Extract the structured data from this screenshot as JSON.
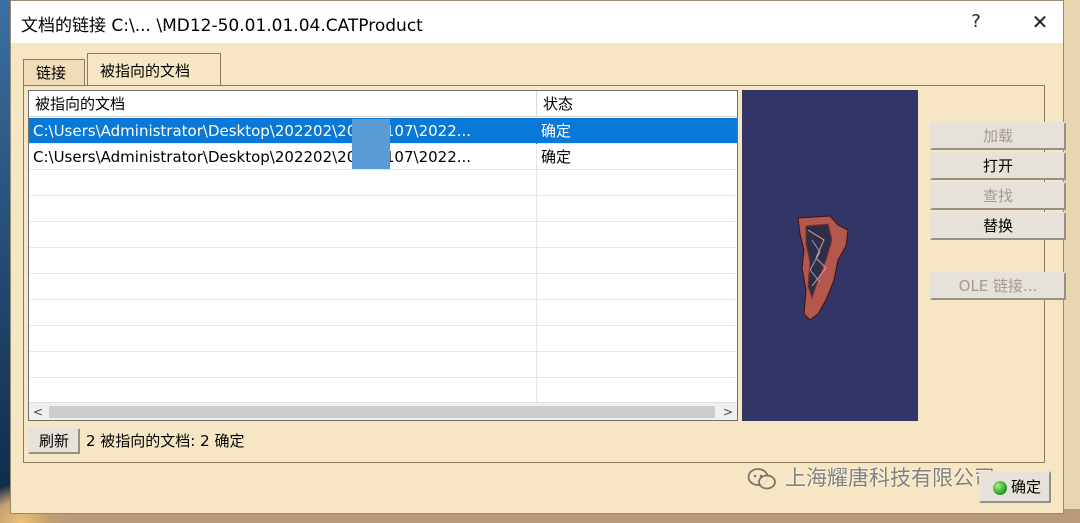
{
  "window": {
    "title": "文档的链接 C:\\... \\MD12-50.01.01.04.CATProduct",
    "help_label": "?",
    "close_label": "✕"
  },
  "tabs": [
    {
      "label": "链接",
      "active": false
    },
    {
      "label": "被指向的文档",
      "active": true
    }
  ],
  "table": {
    "columns": [
      "被指向的文档",
      "状态"
    ],
    "rows": [
      {
        "document": "C:\\Users\\Administrator\\Desktop\\202202\\20220107\\2022...",
        "status": "确定",
        "selected": true
      },
      {
        "document": "C:\\Users\\Administrator\\Desktop\\202202\\20220107\\2022...",
        "status": "确定",
        "selected": false
      }
    ],
    "scroll_left": "<",
    "scroll_right": ">"
  },
  "buttons": {
    "load": {
      "label": "加载",
      "enabled": false
    },
    "open": {
      "label": "打开",
      "enabled": true
    },
    "find": {
      "label": "查找",
      "enabled": false
    },
    "replace": {
      "label": "替换",
      "enabled": true
    },
    "ole": {
      "label": "OLE 链接...",
      "enabled": false
    },
    "refresh": {
      "label": "刷新"
    },
    "ok": {
      "label": "确定"
    }
  },
  "status_text": "2 被指向的文档: 2 确定",
  "watermark": "上海耀唐科技有限公司",
  "colors": {
    "dialog_bg": "#f7e6c4",
    "selection": "#0a78d7",
    "preview_bg": "#343567"
  }
}
